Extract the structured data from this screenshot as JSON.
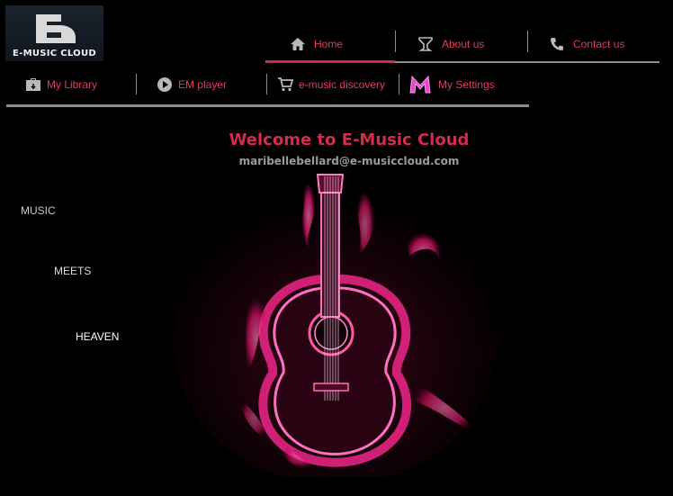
{
  "logo": {
    "text": "E-MUSIC CLOUD"
  },
  "top_nav": [
    {
      "label": "Home",
      "icon": "home-icon",
      "active": true
    },
    {
      "label": "About us",
      "icon": "trophy-icon"
    },
    {
      "label": "Contact us",
      "icon": "phone-icon"
    }
  ],
  "sub_nav": [
    {
      "label": "My Library",
      "icon": "library-icon"
    },
    {
      "label": "EM player",
      "icon": "play-icon"
    },
    {
      "label": "e-music discovery",
      "icon": "cart-icon"
    },
    {
      "label": "My Settings",
      "icon": "m-logo-icon"
    }
  ],
  "welcome": {
    "title": "Welcome to E-Music Cloud",
    "email": "maribellebellard@e-musiccloud.com"
  },
  "tagline": [
    "MUSIC",
    "MEETS",
    "HEAVEN"
  ],
  "colors": {
    "accent": "#e33a5e",
    "title": "#d62a4f",
    "divider": "#8c8c8c",
    "background": "#000000"
  }
}
